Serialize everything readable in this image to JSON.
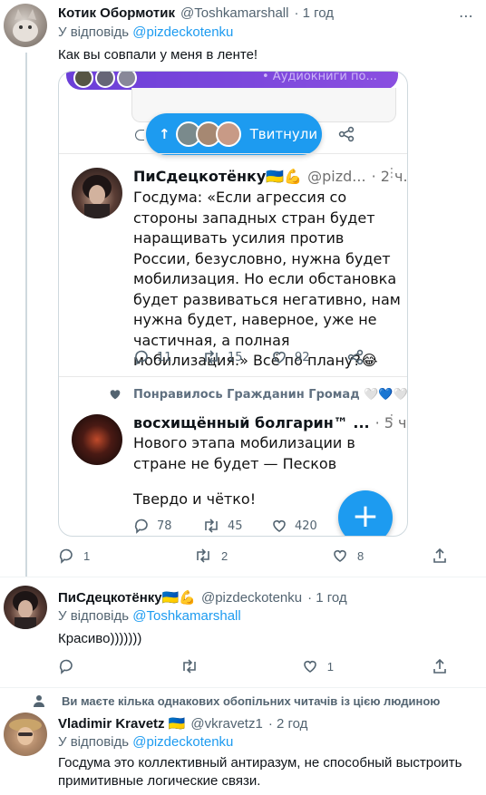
{
  "tweet1": {
    "author_name": "Котик Обормотик",
    "handle": "@Toshkamarshall",
    "time": "· 1 год",
    "reply_prefix": "У відповідь",
    "reply_to": "@pizdeckotenku",
    "text": "Как вы совпали у меня в ленте!",
    "stats": {
      "replies": "1",
      "retweets": "2",
      "likes": "8"
    }
  },
  "embedded_screenshot": {
    "top_banner_text": "• Аудиокниги по...",
    "tweeted_pill_label": "Твитнули",
    "tweet_a": {
      "author_name": "ПиСдецкотёнку🇺🇦💪",
      "handle": "@pizd...",
      "time": "· 2 ч.",
      "text": "Госдума: «Если агрессия со стороны западных стран будет наращивать усилия против России, безусловно, нужна будет мобилизация. Но если обстановка будет развиваться негативно, нам нужна будет, наверное, уже не частичная, а полная мобилизация.»  Всё по плану?😂",
      "stats": {
        "replies": "11",
        "retweets": "15",
        "likes": "92"
      }
    },
    "liked_by_text": "Понравилось Гражданин Громад 🤍💙🤍",
    "tweet_b": {
      "author_name": "восхищённый болгарин™ ...",
      "time": "· 5 ч.",
      "text_line1": "Нового этапа мобилизации в стране не будет — Песков",
      "text_line2": "Твердо и чётко!",
      "stats": {
        "replies": "78",
        "retweets": "45",
        "likes": "420"
      }
    },
    "fab_label": "+"
  },
  "tweet2": {
    "author_name": "ПиСдецкотёнку🇺🇦💪",
    "handle": "@pizdeckotenku",
    "time": "· 1 год",
    "reply_prefix": "У відповідь",
    "reply_to": "@Toshkamarshall",
    "text": "Красиво)))))))",
    "stats": {
      "likes": "1"
    }
  },
  "tweet3": {
    "context_text": "Ви маєте кілька однакових обопільних читачів із цією людиною",
    "author_name": "Vladimir Kravetz 🇺🇦",
    "handle": "@vkravetz1",
    "time": "· 2 год",
    "reply_prefix": "У відповідь",
    "reply_to": "@pizdeckotenku",
    "text": "Госдума это коллективный антиразум, не способный выстроить примитивные логические связи."
  },
  "colors": {
    "accent": "#1d9bf0",
    "muted": "#536471",
    "text": "#0f1419",
    "border": "#eff3f4"
  }
}
